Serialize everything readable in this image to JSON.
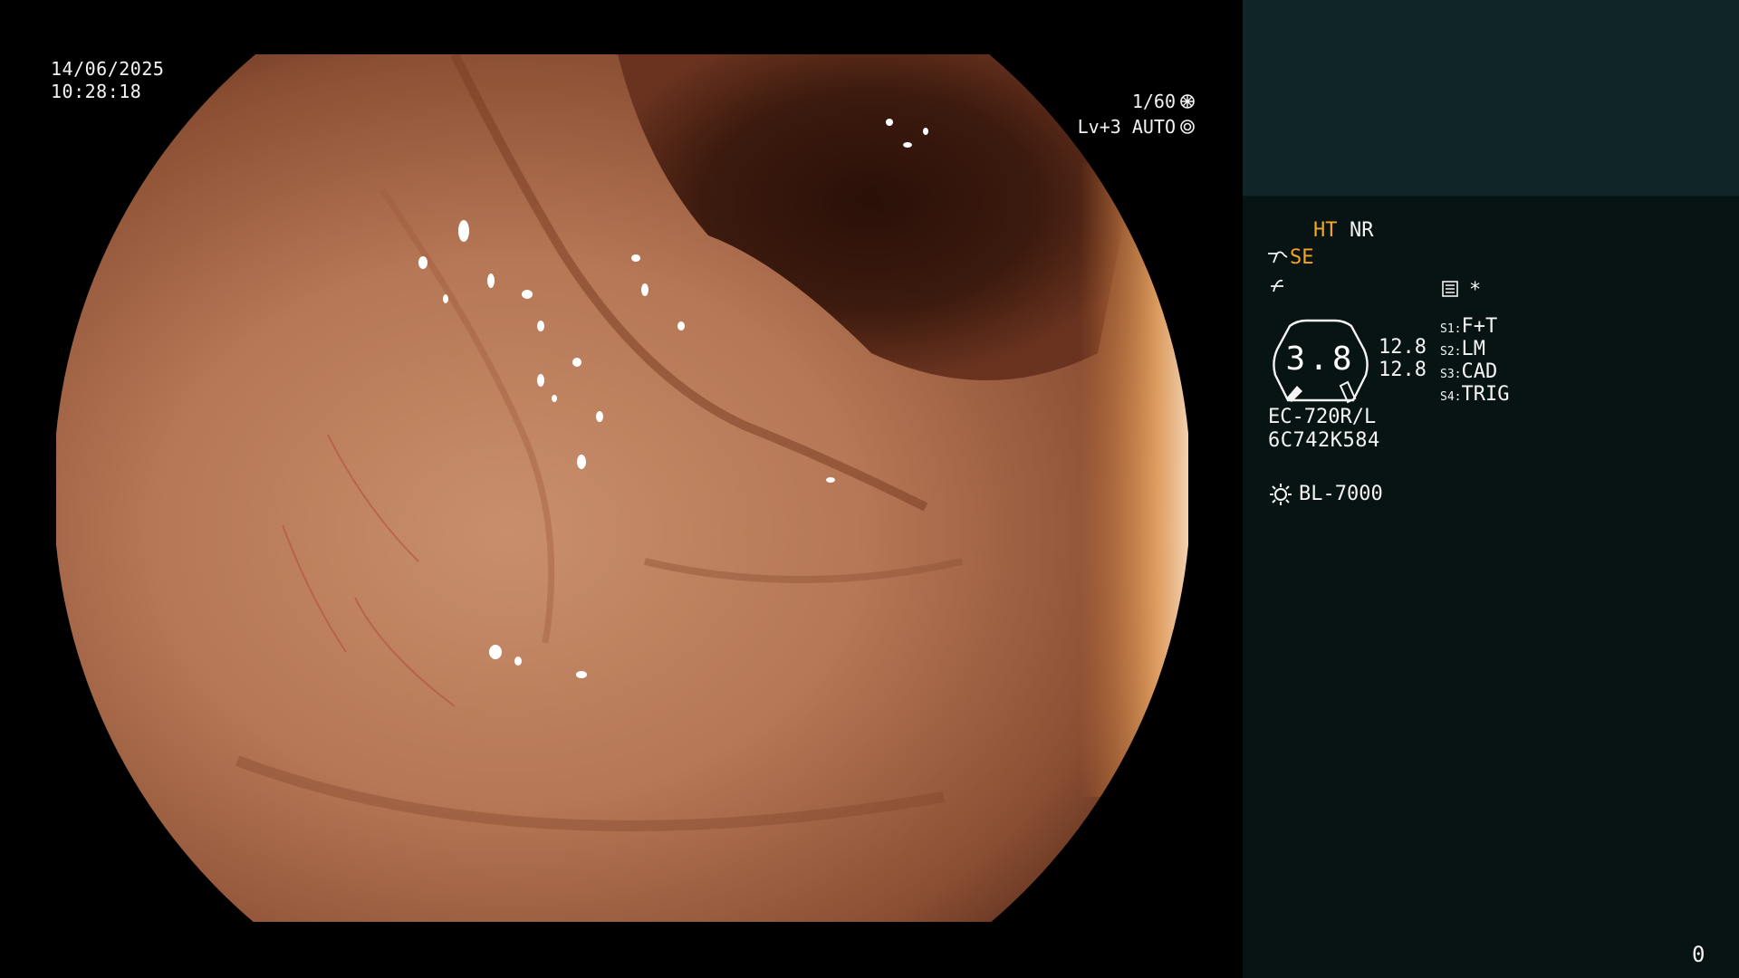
{
  "osd": {
    "date": "14/06/2025",
    "time": "10:28:18",
    "shutter": "1/60",
    "iris": "Lv+3 AUTO"
  },
  "panel": {
    "ht": "HT",
    "nr": "NR",
    "se": "SE",
    "star": "*",
    "dial_value": "3.8",
    "side_values": [
      "12.8",
      "12.8"
    ],
    "switches": [
      {
        "key": "S1:",
        "value": "F+T"
      },
      {
        "key": "S2:",
        "value": "LM"
      },
      {
        "key": "S3:",
        "value": "CAD"
      },
      {
        "key": "S4:",
        "value": "TRIG"
      }
    ],
    "scope_model": "EC-720R/L",
    "scope_serial": "6C742K584",
    "light_source": "BL-7000"
  },
  "corner_counter": "0",
  "colors": {
    "accent_orange": "#f5a623",
    "panel_bg": "#081414",
    "preview_bg": "#0f2527"
  },
  "icons": [
    "scope-se-icon",
    "enhance-icon",
    "memo-icon",
    "lamp-icon",
    "shutter-gear-icon",
    "iris-gear-icon"
  ]
}
